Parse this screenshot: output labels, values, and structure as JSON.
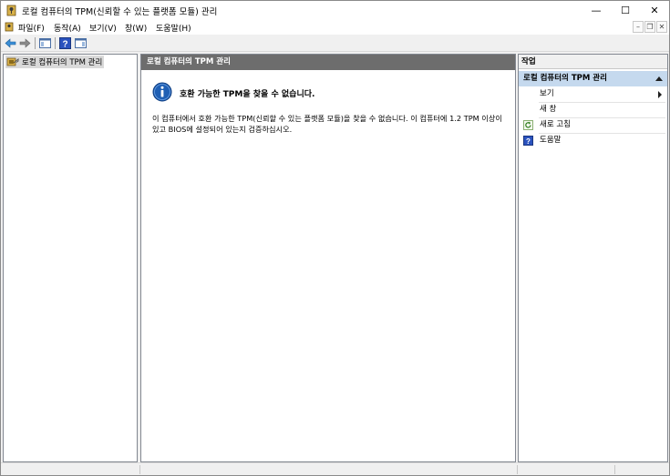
{
  "window": {
    "title": "로컬 컴퓨터의 TPM(신뢰할 수 있는 플랫폼 모듈) 관리",
    "app_icon": "tpm-key-icon",
    "controls": {
      "minimize": "—",
      "maximize": "☐",
      "close": "✕"
    }
  },
  "menubar": {
    "items": [
      {
        "label": "파일(F)"
      },
      {
        "label": "동작(A)"
      },
      {
        "label": "보기(V)"
      },
      {
        "label": "창(W)"
      },
      {
        "label": "도움말(H)"
      }
    ],
    "mdi_controls": {
      "minimize": "–",
      "restore": "❐",
      "close": "✕"
    }
  },
  "toolbar": {
    "buttons": [
      "back-arrow-icon",
      "forward-arrow-icon",
      "show-hide-console-tree-icon",
      "help-icon",
      "show-hide-action-pane-icon"
    ]
  },
  "tree": {
    "root_label": "로컬 컴퓨터의 TPM 관리"
  },
  "center": {
    "header": "로컬 컴퓨터의 TPM 관리",
    "info_heading": "호환 가능한 TPM을 찾을 수 없습니다.",
    "info_body": "이 컴퓨터에서 호환 가능한 TPM(신뢰할 수 있는 플랫폼 모듈)을 찾을 수 없습니다. 이 컴퓨터에 1.2 TPM 이상이 있고 BIOS에 설정되어 있는지 검증하십시오."
  },
  "actions": {
    "header": "작업",
    "group_label": "로컬 컴퓨터의 TPM 관리",
    "items": [
      {
        "label": "보기",
        "icon": "",
        "has_submenu": true
      },
      {
        "label": "새 창",
        "icon": ""
      },
      {
        "label": "새로 고침",
        "icon": "refresh-icon"
      },
      {
        "label": "도움말",
        "icon": "help-icon"
      }
    ]
  },
  "colors": {
    "center_header_bg": "#6d6d6d",
    "actions_group_bg": "#c5d9ee",
    "info_icon_blue": "#1f5fb4"
  }
}
